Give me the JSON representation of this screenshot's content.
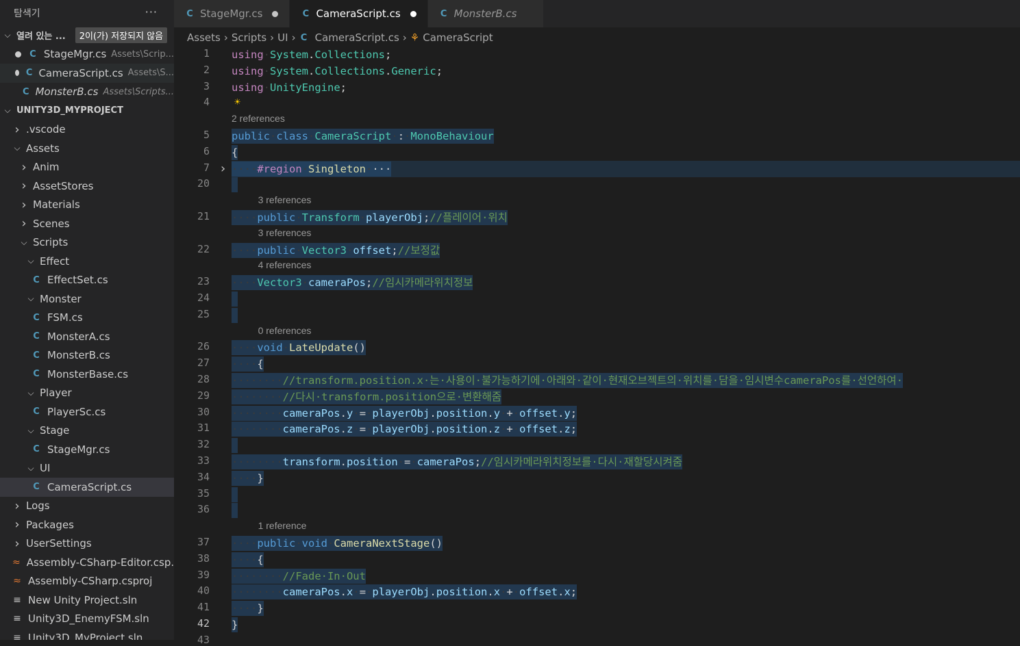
{
  "explorer": {
    "title": "탐색기",
    "more": "···",
    "open_editors": {
      "label": "열려 있는 ...",
      "badge": "2이(가) 저장되지 않음",
      "files": [
        {
          "name": "StageMgr.cs",
          "path": "Assets\\Scrip...",
          "modified": true
        },
        {
          "name": "CameraScript.cs",
          "path": "Assets\\S...",
          "modified": true
        },
        {
          "name": "MonsterB.cs",
          "path": "Assets\\Scripts...",
          "modified": false
        }
      ]
    },
    "project": {
      "label": "UNITY3D_MYPROJECT",
      "items": [
        {
          "label": ".vscode",
          "kind": "folder-closed",
          "depth": 1
        },
        {
          "label": "Assets",
          "kind": "folder-open",
          "depth": 1
        },
        {
          "label": "Anim",
          "kind": "folder-closed",
          "depth": 2
        },
        {
          "label": "AssetStores",
          "kind": "folder-closed",
          "depth": 2
        },
        {
          "label": "Materials",
          "kind": "folder-closed",
          "depth": 2
        },
        {
          "label": "Scenes",
          "kind": "folder-closed",
          "depth": 2
        },
        {
          "label": "Scripts",
          "kind": "folder-open",
          "depth": 2
        },
        {
          "label": "Effect",
          "kind": "folder-open",
          "depth": 3
        },
        {
          "label": "EffectSet.cs",
          "kind": "cs",
          "depth": 4
        },
        {
          "label": "Monster",
          "kind": "folder-open",
          "depth": 3
        },
        {
          "label": "FSM.cs",
          "kind": "cs",
          "depth": 4
        },
        {
          "label": "MonsterA.cs",
          "kind": "cs",
          "depth": 4
        },
        {
          "label": "MonsterB.cs",
          "kind": "cs",
          "depth": 4
        },
        {
          "label": "MonsterBase.cs",
          "kind": "cs",
          "depth": 4
        },
        {
          "label": "Player",
          "kind": "folder-open",
          "depth": 3
        },
        {
          "label": "PlayerSc.cs",
          "kind": "cs",
          "depth": 4
        },
        {
          "label": "Stage",
          "kind": "folder-open",
          "depth": 3
        },
        {
          "label": "StageMgr.cs",
          "kind": "cs",
          "depth": 4
        },
        {
          "label": "UI",
          "kind": "folder-open",
          "depth": 3
        },
        {
          "label": "CameraScript.cs",
          "kind": "cs",
          "depth": 4,
          "selected": true
        },
        {
          "label": "Logs",
          "kind": "folder-closed",
          "depth": 1
        },
        {
          "label": "Packages",
          "kind": "folder-closed",
          "depth": 1
        },
        {
          "label": "UserSettings",
          "kind": "folder-closed",
          "depth": 1
        },
        {
          "label": "Assembly-CSharp-Editor.csp...",
          "kind": "rss",
          "depth": 1
        },
        {
          "label": "Assembly-CSharp.csproj",
          "kind": "rss",
          "depth": 1
        },
        {
          "label": "New Unity Project.sln",
          "kind": "sln",
          "depth": 1
        },
        {
          "label": "Unity3D_EnemyFSM.sln",
          "kind": "sln",
          "depth": 1
        },
        {
          "label": "Unity3D_MyProject.sln",
          "kind": "sln",
          "depth": 1
        }
      ]
    }
  },
  "tabs": [
    {
      "label": "StageMgr.cs",
      "modified": true,
      "active": false,
      "italic": false
    },
    {
      "label": "CameraScript.cs",
      "modified": true,
      "active": true,
      "italic": false
    },
    {
      "label": "MonsterB.cs",
      "modified": false,
      "active": false,
      "italic": true
    }
  ],
  "breadcrumb": [
    "Assets",
    "Scripts",
    "UI",
    "CameraScript.cs",
    "CameraScript"
  ],
  "code_lines": [
    {
      "n": "1",
      "tokens": [
        [
          "kw2",
          "using"
        ],
        [
          "ws",
          "·"
        ],
        [
          "ns",
          "System"
        ],
        [
          "pu",
          "."
        ],
        [
          "ns",
          "Collections"
        ],
        [
          "pu",
          ";"
        ]
      ]
    },
    {
      "n": "2",
      "tokens": [
        [
          "kw2",
          "using"
        ],
        [
          "ws",
          "·"
        ],
        [
          "ns",
          "System"
        ],
        [
          "pu",
          "."
        ],
        [
          "ns",
          "Collections"
        ],
        [
          "pu",
          "."
        ],
        [
          "ns",
          "Generic"
        ],
        [
          "pu",
          ";"
        ]
      ]
    },
    {
      "n": "3",
      "tokens": [
        [
          "kw2",
          "using"
        ],
        [
          "ws",
          "·"
        ],
        [
          "ns",
          "UnityEngine"
        ],
        [
          "pu",
          ";"
        ]
      ]
    },
    {
      "n": "4",
      "tokens": [],
      "bulb": true
    },
    {
      "lens": "2 references"
    },
    {
      "n": "5",
      "sel": true,
      "tokens": [
        [
          "kw",
          "public"
        ],
        [
          "ws",
          "·"
        ],
        [
          "kw",
          "class"
        ],
        [
          "ws",
          "·"
        ],
        [
          "ty",
          "CameraScript"
        ],
        [
          "ws",
          "·"
        ],
        [
          "pu",
          ":"
        ],
        [
          "ws",
          "·"
        ],
        [
          "ty",
          "MonoBehaviour"
        ]
      ]
    },
    {
      "n": "6",
      "sel": true,
      "tokens": [
        [
          "pu",
          "{"
        ]
      ]
    },
    {
      "n": "7",
      "sel": true,
      "fold": true,
      "region": true,
      "tokens": [
        [
          "ws",
          "····"
        ],
        [
          "rgn",
          "#region"
        ],
        [
          "ws",
          "·"
        ],
        [
          "fn",
          "Singleton"
        ],
        [
          "ws",
          "·"
        ],
        [
          "pu",
          "···"
        ]
      ]
    },
    {
      "n": "20",
      "sel": true,
      "tokens": []
    },
    {
      "lens": "3 references",
      "indent": 1
    },
    {
      "n": "21",
      "sel": true,
      "tokens": [
        [
          "ws",
          "····"
        ],
        [
          "kw",
          "public"
        ],
        [
          "ws",
          "·"
        ],
        [
          "ty",
          "Transform"
        ],
        [
          "ws",
          "·"
        ],
        [
          "va",
          "playerObj"
        ],
        [
          "pu",
          ";"
        ],
        [
          "cm",
          "//플레이어·위치"
        ]
      ]
    },
    {
      "lens": "3 references",
      "indent": 1
    },
    {
      "n": "22",
      "sel": true,
      "tokens": [
        [
          "ws",
          "····"
        ],
        [
          "kw",
          "public"
        ],
        [
          "ws",
          "·"
        ],
        [
          "ty",
          "Vector3"
        ],
        [
          "ws",
          "·"
        ],
        [
          "va",
          "offset"
        ],
        [
          "pu",
          ";"
        ],
        [
          "cm",
          "//보정값"
        ]
      ]
    },
    {
      "lens": "4 references",
      "indent": 1
    },
    {
      "n": "23",
      "sel": true,
      "tokens": [
        [
          "ws",
          "····"
        ],
        [
          "ty",
          "Vector3"
        ],
        [
          "ws",
          "·"
        ],
        [
          "va",
          "cameraPos"
        ],
        [
          "pu",
          ";"
        ],
        [
          "cm",
          "//임시카메라위치정보"
        ]
      ]
    },
    {
      "n": "24",
      "sel": true,
      "tokens": []
    },
    {
      "n": "25",
      "sel": true,
      "tokens": []
    },
    {
      "lens": "0 references",
      "indent": 1
    },
    {
      "n": "26",
      "sel": true,
      "tokens": [
        [
          "ws",
          "····"
        ],
        [
          "kw",
          "void"
        ],
        [
          "ws",
          "·"
        ],
        [
          "fn",
          "LateUpdate"
        ],
        [
          "pu",
          "()"
        ]
      ]
    },
    {
      "n": "27",
      "sel": true,
      "tokens": [
        [
          "ws",
          "····"
        ],
        [
          "pu",
          "{"
        ]
      ]
    },
    {
      "n": "28",
      "sel": true,
      "tokens": [
        [
          "ws",
          "········"
        ],
        [
          "cm",
          "//transform.position.x·는·사용이·불가능하기에·아래와·같이·현재오브젝트의·위치를·담을·임시변수cameraPos를·선언하여·"
        ]
      ]
    },
    {
      "n": "29",
      "sel": true,
      "tokens": [
        [
          "ws",
          "········"
        ],
        [
          "cm",
          "//다시·transform.position으로·변환해줌"
        ]
      ]
    },
    {
      "n": "30",
      "sel": true,
      "tokens": [
        [
          "ws",
          "········"
        ],
        [
          "va",
          "cameraPos"
        ],
        [
          "pu",
          "."
        ],
        [
          "va",
          "y"
        ],
        [
          "ws",
          "·"
        ],
        [
          "pu",
          "="
        ],
        [
          "ws",
          "·"
        ],
        [
          "va",
          "playerObj"
        ],
        [
          "pu",
          "."
        ],
        [
          "va",
          "position"
        ],
        [
          "pu",
          "."
        ],
        [
          "va",
          "y"
        ],
        [
          "ws",
          "·"
        ],
        [
          "pu",
          "+"
        ],
        [
          "ws",
          "·"
        ],
        [
          "va",
          "offset"
        ],
        [
          "pu",
          "."
        ],
        [
          "va",
          "y"
        ],
        [
          "pu",
          ";"
        ]
      ]
    },
    {
      "n": "31",
      "sel": true,
      "tokens": [
        [
          "ws",
          "········"
        ],
        [
          "va",
          "cameraPos"
        ],
        [
          "pu",
          "."
        ],
        [
          "va",
          "z"
        ],
        [
          "ws",
          "·"
        ],
        [
          "pu",
          "="
        ],
        [
          "ws",
          "·"
        ],
        [
          "va",
          "playerObj"
        ],
        [
          "pu",
          "."
        ],
        [
          "va",
          "position"
        ],
        [
          "pu",
          "."
        ],
        [
          "va",
          "z"
        ],
        [
          "ws",
          "·"
        ],
        [
          "pu",
          "+"
        ],
        [
          "ws",
          "·"
        ],
        [
          "va",
          "offset"
        ],
        [
          "pu",
          "."
        ],
        [
          "va",
          "z"
        ],
        [
          "pu",
          ";"
        ]
      ]
    },
    {
      "n": "32",
      "sel": true,
      "tokens": []
    },
    {
      "n": "33",
      "sel": true,
      "tokens": [
        [
          "ws",
          "········"
        ],
        [
          "va",
          "transform"
        ],
        [
          "pu",
          "."
        ],
        [
          "va",
          "position"
        ],
        [
          "ws",
          "·"
        ],
        [
          "pu",
          "="
        ],
        [
          "ws",
          "·"
        ],
        [
          "va",
          "cameraPos"
        ],
        [
          "pu",
          ";"
        ],
        [
          "cm",
          "//임시카메라위치정보를·다시·재할당시켜줌"
        ]
      ]
    },
    {
      "n": "34",
      "sel": true,
      "tokens": [
        [
          "ws",
          "····"
        ],
        [
          "pu",
          "}"
        ]
      ]
    },
    {
      "n": "35",
      "sel": true,
      "tokens": []
    },
    {
      "n": "36",
      "sel": true,
      "tokens": []
    },
    {
      "lens": "1 reference",
      "indent": 1
    },
    {
      "n": "37",
      "sel": true,
      "tokens": [
        [
          "ws",
          "····"
        ],
        [
          "kw",
          "public"
        ],
        [
          "ws",
          "·"
        ],
        [
          "kw",
          "void"
        ],
        [
          "ws",
          "·"
        ],
        [
          "fn",
          "CameraNextStage"
        ],
        [
          "pu",
          "()"
        ]
      ]
    },
    {
      "n": "38",
      "sel": true,
      "tokens": [
        [
          "ws",
          "····"
        ],
        [
          "pu",
          "{"
        ]
      ]
    },
    {
      "n": "39",
      "sel": true,
      "tokens": [
        [
          "ws",
          "········"
        ],
        [
          "cm",
          "//Fade·In·Out"
        ]
      ]
    },
    {
      "n": "40",
      "sel": true,
      "tokens": [
        [
          "ws",
          "········"
        ],
        [
          "va",
          "cameraPos"
        ],
        [
          "pu",
          "."
        ],
        [
          "va",
          "x"
        ],
        [
          "ws",
          "·"
        ],
        [
          "pu",
          "="
        ],
        [
          "ws",
          "·"
        ],
        [
          "va",
          "playerObj"
        ],
        [
          "pu",
          "."
        ],
        [
          "va",
          "position"
        ],
        [
          "pu",
          "."
        ],
        [
          "va",
          "x"
        ],
        [
          "ws",
          "·"
        ],
        [
          "pu",
          "+"
        ],
        [
          "ws",
          "·"
        ],
        [
          "va",
          "offset"
        ],
        [
          "pu",
          "."
        ],
        [
          "va",
          "x"
        ],
        [
          "pu",
          ";"
        ]
      ]
    },
    {
      "n": "41",
      "sel": true,
      "tokens": [
        [
          "ws",
          "····"
        ],
        [
          "pu",
          "}"
        ]
      ]
    },
    {
      "n": "42",
      "sel": true,
      "cur": true,
      "tokens": [
        [
          "pu",
          "}"
        ]
      ]
    },
    {
      "n": "43",
      "tokens": []
    }
  ],
  "colors": {
    "editor_bg": "#1e1e1e",
    "sidebar_bg": "#252526",
    "selection": "#264f78",
    "keyword": "#569cd6",
    "type": "#4ec9b0",
    "comment": "#6a9955"
  }
}
